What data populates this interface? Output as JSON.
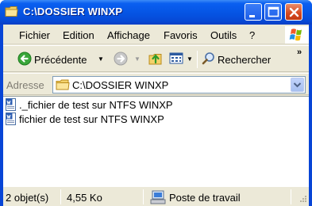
{
  "window": {
    "title": "C:\\DOSSIER WINXP",
    "icon": "folder-icon",
    "controls": [
      "minimize-icon",
      "maximize-icon",
      "close-icon"
    ]
  },
  "menubar": {
    "items": [
      "Fichier",
      "Edition",
      "Affichage",
      "Favoris",
      "Outils",
      "?"
    ]
  },
  "toolbar": {
    "back_label": "Précédente",
    "search_label": "Rechercher",
    "overflow": "»"
  },
  "addressbar": {
    "label": "Adresse",
    "value": "C:\\DOSSIER WINXP"
  },
  "files": [
    {
      "name": "._fichier de test sur NTFS WINXP",
      "icon": "text-document-icon"
    },
    {
      "name": "fichier de test sur NTFS WINXP",
      "icon": "text-document-icon"
    }
  ],
  "statusbar": {
    "count": "2 objet(s)",
    "size": "4,55 Ko",
    "location": "Poste de travail"
  },
  "colors": {
    "titlebar": "#0554e3",
    "chrome": "#ece9d8",
    "close_button": "#d6481f"
  }
}
